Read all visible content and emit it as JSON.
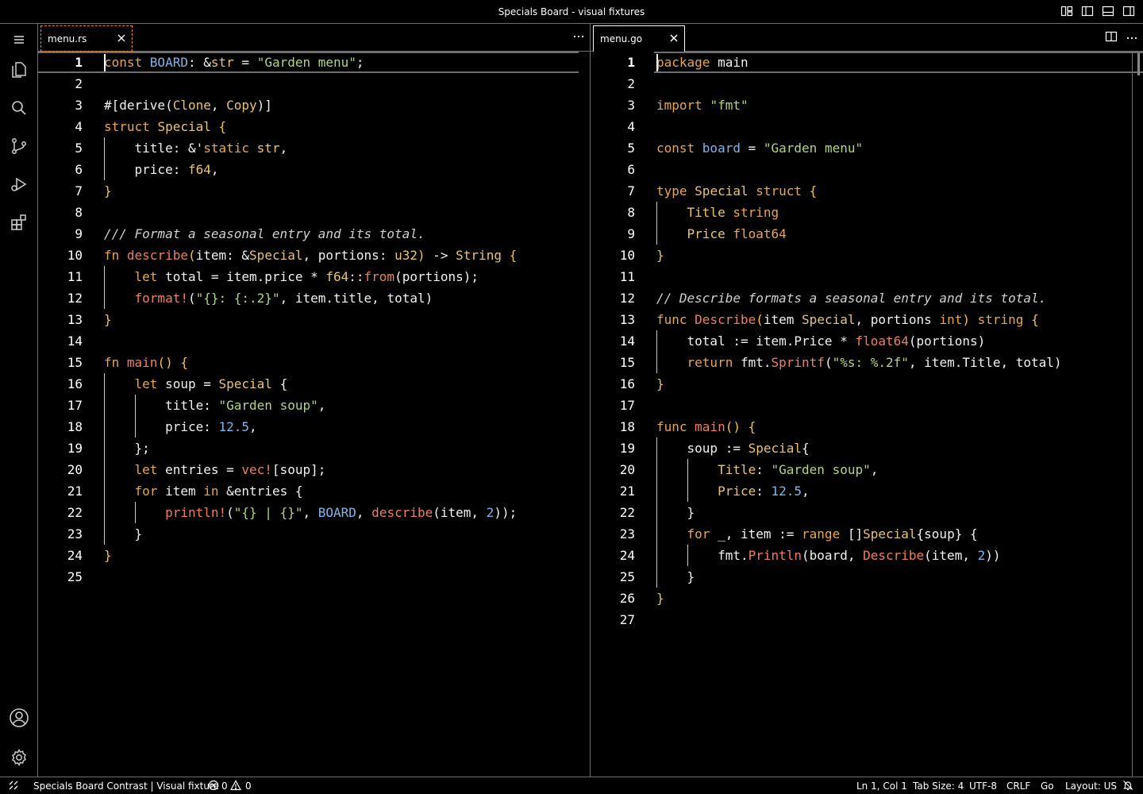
{
  "window": {
    "title": "Specials Board - visual fixtures"
  },
  "activity": [
    "explorer-icon",
    "search-icon",
    "source-control-icon",
    "run-debug-icon",
    "extensions-icon",
    "accounts-icon",
    "settings-gear-icon"
  ],
  "left_editor": {
    "tab": "menu.rs",
    "active_line": "1",
    "lines": [
      {
        "n": "1",
        "segs": [
          [
            "k",
            "const "
          ],
          [
            "n",
            "BOARD"
          ],
          [
            "v",
            ": &"
          ],
          [
            "t",
            "str"
          ],
          [
            "v",
            " = "
          ],
          [
            "s",
            "\"Garden menu\""
          ],
          [
            "v",
            ";"
          ]
        ]
      },
      {
        "n": "2",
        "segs": []
      },
      {
        "n": "3",
        "segs": [
          [
            "v",
            "#[derive("
          ],
          [
            "t",
            "Clone"
          ],
          [
            "v",
            ", "
          ],
          [
            "t",
            "Copy"
          ],
          [
            "v",
            ")]"
          ]
        ]
      },
      {
        "n": "4",
        "segs": [
          [
            "k",
            "struct "
          ],
          [
            "t",
            "Special "
          ],
          [
            "b1",
            "{"
          ]
        ]
      },
      {
        "n": "5",
        "segs": [
          [
            "v",
            "    title: &'"
          ],
          [
            "k",
            "static "
          ],
          [
            "t",
            "str"
          ],
          [
            "v",
            ","
          ]
        ]
      },
      {
        "n": "6",
        "segs": [
          [
            "v",
            "    price: "
          ],
          [
            "t",
            "f64"
          ],
          [
            "v",
            ","
          ]
        ]
      },
      {
        "n": "7",
        "segs": [
          [
            "b1",
            "}"
          ]
        ]
      },
      {
        "n": "8",
        "segs": []
      },
      {
        "n": "9",
        "segs": [
          [
            "c",
            "/// Format a seasonal entry and its total."
          ]
        ]
      },
      {
        "n": "10",
        "segs": [
          [
            "k",
            "fn "
          ],
          [
            "f",
            "describe"
          ],
          [
            "b1",
            "("
          ],
          [
            "v",
            "item: &"
          ],
          [
            "t",
            "Special"
          ],
          [
            "v",
            ", portions: "
          ],
          [
            "t",
            "u32"
          ],
          [
            "b1",
            ")"
          ],
          [
            "v",
            " -> "
          ],
          [
            "t",
            "String "
          ],
          [
            "b1",
            "{"
          ]
        ]
      },
      {
        "n": "11",
        "segs": [
          [
            "k",
            "    let "
          ],
          [
            "v",
            "total = item.price * "
          ],
          [
            "t",
            "f64"
          ],
          [
            "v",
            "::"
          ],
          [
            "f",
            "from"
          ],
          [
            "v",
            "(portions);"
          ]
        ]
      },
      {
        "n": "12",
        "segs": [
          [
            "f",
            "    format!"
          ],
          [
            "v",
            "("
          ],
          [
            "s",
            "\"{}: {:.2}\""
          ],
          [
            "v",
            ", item.title, total)"
          ]
        ]
      },
      {
        "n": "13",
        "segs": [
          [
            "b1",
            "}"
          ]
        ]
      },
      {
        "n": "14",
        "segs": []
      },
      {
        "n": "15",
        "segs": [
          [
            "k",
            "fn "
          ],
          [
            "f",
            "main"
          ],
          [
            "b1",
            "() {"
          ]
        ]
      },
      {
        "n": "16",
        "segs": [
          [
            "k",
            "    let "
          ],
          [
            "v",
            "soup = "
          ],
          [
            "t",
            "Special "
          ],
          [
            "v",
            "{"
          ]
        ]
      },
      {
        "n": "17",
        "segs": [
          [
            "v",
            "        title: "
          ],
          [
            "s",
            "\"Garden soup\""
          ],
          [
            "v",
            ","
          ]
        ]
      },
      {
        "n": "18",
        "segs": [
          [
            "v",
            "        price: "
          ],
          [
            "n",
            "12.5"
          ],
          [
            "v",
            ","
          ]
        ]
      },
      {
        "n": "19",
        "segs": [
          [
            "v",
            "    };"
          ]
        ]
      },
      {
        "n": "20",
        "segs": [
          [
            "k",
            "    let "
          ],
          [
            "v",
            "entries = "
          ],
          [
            "f",
            "vec!"
          ],
          [
            "v",
            "[soup];"
          ]
        ]
      },
      {
        "n": "21",
        "segs": [
          [
            "k",
            "    for "
          ],
          [
            "v",
            "item "
          ],
          [
            "k",
            "in "
          ],
          [
            "v",
            "&entries {"
          ]
        ]
      },
      {
        "n": "22",
        "segs": [
          [
            "f",
            "        println!"
          ],
          [
            "v",
            "("
          ],
          [
            "s",
            "\"{} | {}\""
          ],
          [
            "v",
            ", "
          ],
          [
            "n",
            "BOARD"
          ],
          [
            "v",
            ", "
          ],
          [
            "f",
            "describe"
          ],
          [
            "v",
            "(item, "
          ],
          [
            "n",
            "2"
          ],
          [
            "v",
            "));"
          ]
        ]
      },
      {
        "n": "23",
        "segs": [
          [
            "v",
            "    }"
          ]
        ]
      },
      {
        "n": "24",
        "segs": [
          [
            "b1",
            "}"
          ]
        ]
      },
      {
        "n": "25",
        "segs": []
      }
    ]
  },
  "right_editor": {
    "tab": "menu.go",
    "active_line": "1",
    "lines": [
      {
        "n": "1",
        "segs": [
          [
            "k",
            "package "
          ],
          [
            "v",
            "main"
          ]
        ]
      },
      {
        "n": "2",
        "segs": []
      },
      {
        "n": "3",
        "segs": [
          [
            "k",
            "import "
          ],
          [
            "s",
            "\"fmt\""
          ]
        ]
      },
      {
        "n": "4",
        "segs": []
      },
      {
        "n": "5",
        "segs": [
          [
            "k",
            "const "
          ],
          [
            "n",
            "board"
          ],
          [
            "v",
            " = "
          ],
          [
            "s",
            "\"Garden menu\""
          ]
        ]
      },
      {
        "n": "6",
        "segs": []
      },
      {
        "n": "7",
        "segs": [
          [
            "k",
            "type "
          ],
          [
            "t",
            "Special "
          ],
          [
            "k",
            "struct "
          ],
          [
            "b1",
            "{"
          ]
        ]
      },
      {
        "n": "8",
        "segs": [
          [
            "t",
            "    Title "
          ],
          [
            "k",
            "string"
          ]
        ]
      },
      {
        "n": "9",
        "segs": [
          [
            "t",
            "    Price "
          ],
          [
            "k",
            "float64"
          ]
        ]
      },
      {
        "n": "10",
        "segs": [
          [
            "b1",
            "}"
          ]
        ]
      },
      {
        "n": "11",
        "segs": []
      },
      {
        "n": "12",
        "segs": [
          [
            "c",
            "// Describe formats a seasonal entry and its total."
          ]
        ]
      },
      {
        "n": "13",
        "segs": [
          [
            "k",
            "func "
          ],
          [
            "f",
            "Describe"
          ],
          [
            "b1",
            "("
          ],
          [
            "v",
            "item "
          ],
          [
            "t",
            "Special"
          ],
          [
            "v",
            ", portions "
          ],
          [
            "k",
            "int"
          ],
          [
            "b1",
            ") "
          ],
          [
            "k",
            "string "
          ],
          [
            "b1",
            "{"
          ]
        ]
      },
      {
        "n": "14",
        "segs": [
          [
            "v",
            "    total := item.Price * "
          ],
          [
            "f",
            "float64"
          ],
          [
            "v",
            "(portions)"
          ]
        ]
      },
      {
        "n": "15",
        "segs": [
          [
            "k",
            "    return "
          ],
          [
            "v",
            "fmt."
          ],
          [
            "f",
            "Sprintf"
          ],
          [
            "v",
            "("
          ],
          [
            "s",
            "\"%s: %.2f\""
          ],
          [
            "v",
            ", item.Title, total)"
          ]
        ]
      },
      {
        "n": "16",
        "segs": [
          [
            "b1",
            "}"
          ]
        ]
      },
      {
        "n": "17",
        "segs": []
      },
      {
        "n": "18",
        "segs": [
          [
            "k",
            "func "
          ],
          [
            "f",
            "main"
          ],
          [
            "b1",
            "() {"
          ]
        ]
      },
      {
        "n": "19",
        "segs": [
          [
            "v",
            "    soup := "
          ],
          [
            "t",
            "Special"
          ],
          [
            "v",
            "{"
          ]
        ]
      },
      {
        "n": "20",
        "segs": [
          [
            "t",
            "        Title"
          ],
          [
            "v",
            ": "
          ],
          [
            "s",
            "\"Garden soup\""
          ],
          [
            "v",
            ","
          ]
        ]
      },
      {
        "n": "21",
        "segs": [
          [
            "t",
            "        Price"
          ],
          [
            "v",
            ": "
          ],
          [
            "n",
            "12.5"
          ],
          [
            "v",
            ","
          ]
        ]
      },
      {
        "n": "22",
        "segs": [
          [
            "v",
            "    }"
          ]
        ]
      },
      {
        "n": "23",
        "segs": [
          [
            "k",
            "    for "
          ],
          [
            "v",
            "_, item := "
          ],
          [
            "k",
            "range "
          ],
          [
            "v",
            "[]"
          ],
          [
            "t",
            "Special"
          ],
          [
            "v",
            "{soup} {"
          ]
        ]
      },
      {
        "n": "24",
        "segs": [
          [
            "v",
            "        fmt."
          ],
          [
            "f",
            "Println"
          ],
          [
            "v",
            "(board, "
          ],
          [
            "f",
            "Describe"
          ],
          [
            "v",
            "(item, "
          ],
          [
            "n",
            "2"
          ],
          [
            "v",
            "))"
          ]
        ]
      },
      {
        "n": "25",
        "segs": [
          [
            "v",
            "    }"
          ]
        ]
      },
      {
        "n": "26",
        "segs": [
          [
            "b1",
            "}"
          ]
        ]
      },
      {
        "n": "27",
        "segs": []
      }
    ]
  },
  "status": {
    "remote": "Specials Board Contrast | Visual fixture",
    "errors": "0",
    "warnings": "0",
    "position": "Ln 1, Col 1",
    "tab_size": "Tab Size: 4",
    "encoding": "UTF-8",
    "eol": "CRLF",
    "language": "Go",
    "layout": "Layout: US"
  }
}
